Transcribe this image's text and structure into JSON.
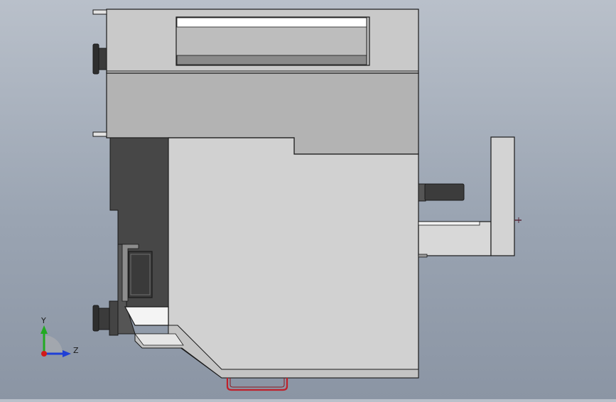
{
  "triad": {
    "y_label": "Y",
    "z_label": "Z"
  },
  "colors": {
    "y_axis": "#22aa22",
    "z_axis": "#1f3fd6",
    "origin": "#d21a1a",
    "handle": "#c0202a",
    "outline": "#1a1a1a"
  }
}
